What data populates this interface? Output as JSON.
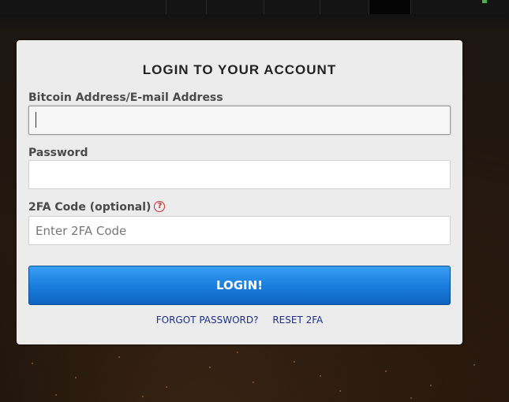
{
  "login": {
    "title": "LOGIN TO YOUR ACCOUNT",
    "address_label": "Bitcoin Address/E-mail Address",
    "address_value": "",
    "password_label": "Password",
    "password_value": "",
    "twofa_label": "2FA Code (optional)",
    "twofa_placeholder": "Enter 2FA Code",
    "help_glyph": "?",
    "submit_label": "LOGIN!",
    "forgot_password_label": "FORGOT PASSWORD?",
    "reset_2fa_label": "RESET 2FA"
  },
  "icons": {
    "help": "question-circle-icon"
  },
  "colors": {
    "button_blue": "#1a7fe0",
    "link_blue": "#1d2f8a",
    "help_red": "#c0302f"
  }
}
